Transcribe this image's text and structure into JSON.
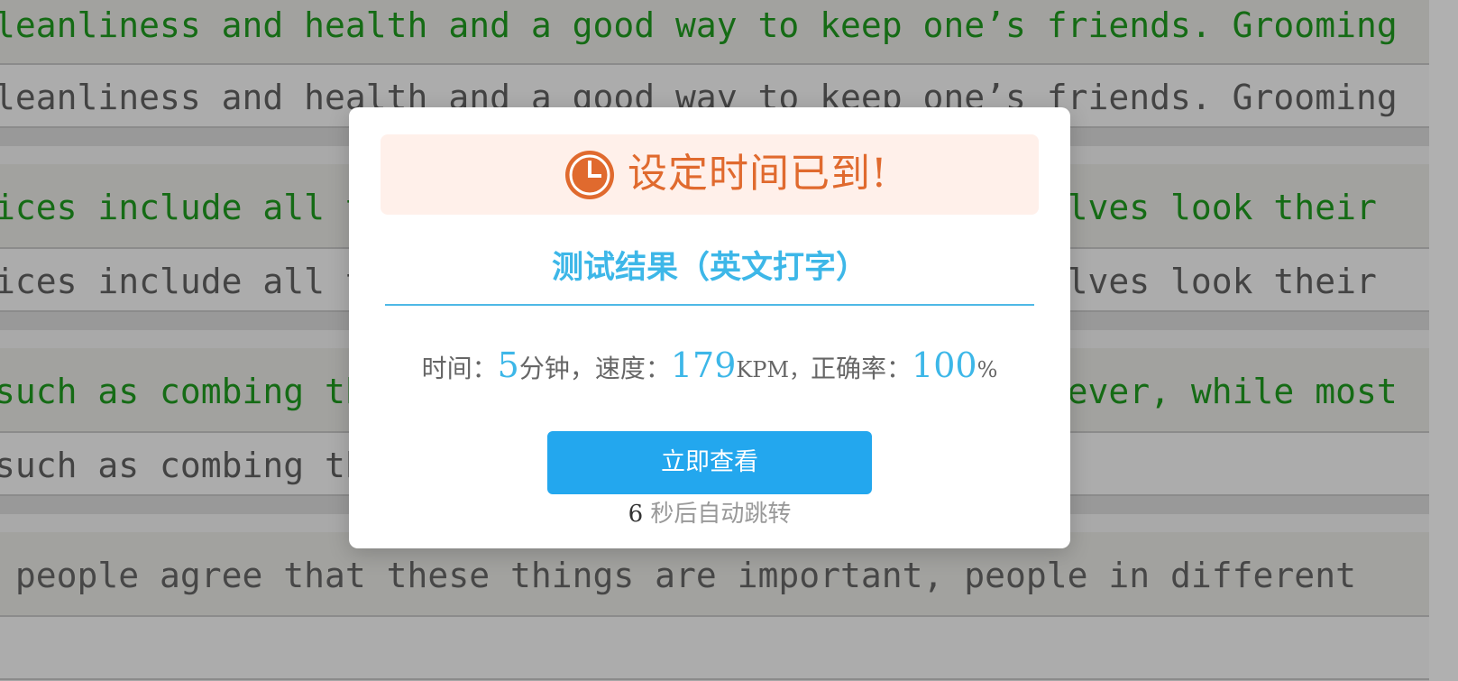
{
  "typing": {
    "groups": [
      {
        "source": "leanliness and health and a good way to keep one’s friends. Grooming",
        "typed": "leanliness and health and a good way to keep one’s friends. Grooming",
        "source_green": true
      },
      {
        "source": "ices include all the things people do to make themselves look their",
        "typed": "ices include all the things people do to make themselves look their",
        "source_green": true
      },
      {
        "source": "such as combing the hair and cleaning the teeth. However, while most",
        "typed": "such as combing the",
        "source_green": true
      },
      {
        "source": " people agree that these things are important, people in different",
        "typed": "",
        "source_green": false
      }
    ]
  },
  "dialog": {
    "alert_title": "设定时间已到!",
    "result_title": "测试结果（英文打字）",
    "stats": {
      "time_label": "时间：",
      "time_value": "5",
      "time_unit": "分钟，",
      "speed_label": "速度：",
      "speed_value": "179",
      "speed_unit": "KPM，",
      "accuracy_label": "正确率：",
      "accuracy_value": "100",
      "accuracy_unit": "%"
    },
    "view_button": "立即查看",
    "countdown_seconds": "6",
    "countdown_text": " 秒后自动跳转"
  },
  "colors": {
    "accent_blue": "#23a7ee",
    "alert_orange": "#e06a2e",
    "typed_correct_green": "#1f9a1f"
  },
  "icons": {
    "alert": "clock-icon"
  }
}
